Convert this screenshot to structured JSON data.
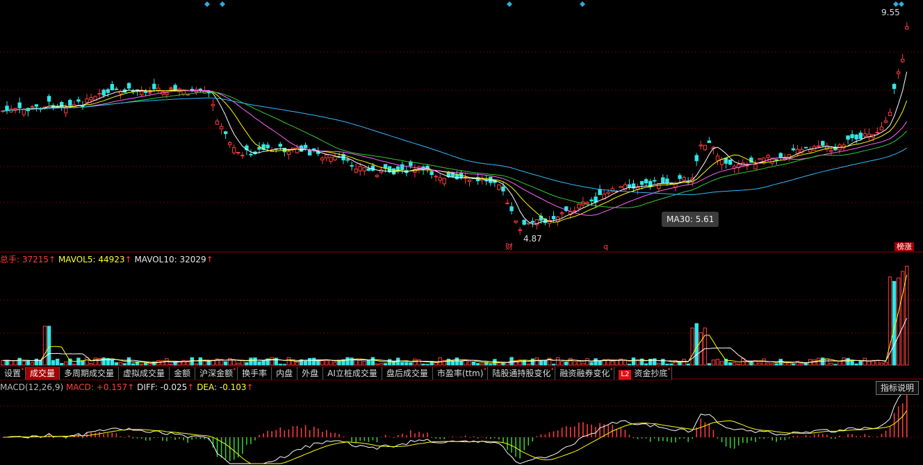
{
  "price_panel": {
    "high_label": "9.55",
    "low_label": "4.87",
    "tooltip": "MA30: 5.61",
    "markers": {
      "cai": "财",
      "q": "q",
      "bang": "榜涨"
    },
    "colors": {
      "up": "#ff3b3b",
      "down": "#33e6e6",
      "ma5": "#ffffff",
      "ma10": "#ffff00",
      "ma20": "#ff66ff",
      "ma30": "#33cc33",
      "ma60": "#33bbff"
    }
  },
  "volume_info": {
    "total_label": "总手: ",
    "total_value": "37215",
    "total_arrow": "↑",
    "mavol5_label": "MAVOL5: ",
    "mavol5_value": "44923",
    "mavol5_arrow": "↑",
    "mavol10_label": "MAVOL10: ",
    "mavol10_value": "32029",
    "mavol10_arrow": "↑"
  },
  "tabs": [
    {
      "label": "设置",
      "dot": true,
      "active": false
    },
    {
      "label": "成交量",
      "dot": false,
      "active": true
    },
    {
      "label": "多周期成交量",
      "dot": false,
      "active": false
    },
    {
      "label": "虚拟成交量",
      "dot": false,
      "active": false
    },
    {
      "label": "金额",
      "dot": false,
      "active": false
    },
    {
      "label": "沪深金额",
      "dot": true,
      "active": false
    },
    {
      "label": "换手率",
      "dot": false,
      "active": false
    },
    {
      "label": "内盘",
      "dot": false,
      "active": false
    },
    {
      "label": "外盘",
      "dot": false,
      "active": false
    },
    {
      "label": "AI立桩成交量",
      "dot": false,
      "active": false
    },
    {
      "label": "盘后成交量",
      "dot": false,
      "active": false
    },
    {
      "label": "市盈率(ttm)",
      "dot": true,
      "active": false
    },
    {
      "label": "陆股通持股变化",
      "dot": true,
      "active": false
    },
    {
      "label": "融资融券变化",
      "dot": true,
      "active": false
    },
    {
      "label": "资金抄底",
      "dot": true,
      "active": false,
      "badge": "L2"
    }
  ],
  "macd_info": {
    "title": "MACD(12,26,9) ",
    "macd_label": "MACD: ",
    "macd_value": "+0.157",
    "macd_arrow": "↑",
    "diff_label": "DIFF: ",
    "diff_value": "-0.025",
    "diff_arrow": "↑",
    "dea_label": "DEA: ",
    "dea_value": "-0.103",
    "dea_arrow": "↑"
  },
  "help_button": "指标说明"
}
